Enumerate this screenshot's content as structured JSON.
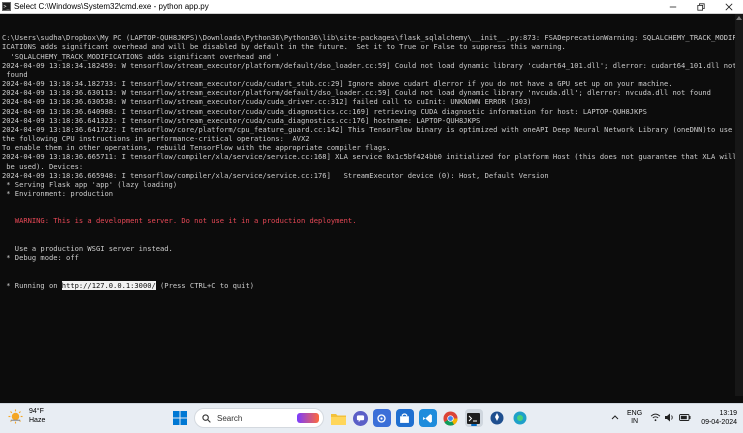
{
  "window": {
    "title": "Select C:\\Windows\\System32\\cmd.exe - python  app.py",
    "minimize": "–",
    "restore": "❐",
    "close": "✕"
  },
  "console": {
    "lines": [
      "C:\\Users\\sudha\\Dropbox\\My PC (LAPTOP-QUH8JKPS)\\Downloads\\Python36\\Python36\\lib\\site-packages\\flask_sqlalchemy\\__init__.py:873: FSADeprecationWarning: SQLALCHEMY_TRACK_MODIF",
      "ICATIONS adds significant overhead and will be disabled by default in the future.  Set it to True or False to suppress this warning.",
      "  'SQLALCHEMY_TRACK_MODIFICATIONS adds significant overhead and '",
      "2024-04-09 13:18:34.182459: W tensorflow/stream_executor/platform/default/dso_loader.cc:59] Could not load dynamic library 'cudart64_101.dll'; dlerror: cudart64_101.dll not",
      " found",
      "2024-04-09 13:18:34.182733: I tensorflow/stream_executor/cuda/cudart_stub.cc:29] Ignore above cudart dlerror if you do not have a GPU set up on your machine.",
      "2024-04-09 13:18:36.630113: W tensorflow/stream_executor/platform/default/dso_loader.cc:59] Could not load dynamic library 'nvcuda.dll'; dlerror: nvcuda.dll not found",
      "2024-04-09 13:18:36.630538: W tensorflow/stream_executor/cuda/cuda_driver.cc:312] failed call to cuInit: UNKNOWN ERROR (303)",
      "2024-04-09 13:18:36.640988: I tensorflow/stream_executor/cuda/cuda_diagnostics.cc:169] retrieving CUDA diagnostic information for host: LAPTOP-QUH8JKPS",
      "2024-04-09 13:18:36.641323: I tensorflow/stream_executor/cuda/cuda_diagnostics.cc:176] hostname: LAPTOP-QUH8JKPS",
      "2024-04-09 13:18:36.641722: I tensorflow/core/platform/cpu_feature_guard.cc:142] This TensorFlow binary is optimized with oneAPI Deep Neural Network Library (oneDNN)to use",
      "the following CPU instructions in performance-critical operations:  AVX2",
      "To enable them in other operations, rebuild TensorFlow with the appropriate compiler flags.",
      "2024-04-09 13:18:36.665711: I tensorflow/compiler/xla/service/service.cc:168] XLA service 0x1c5bf424bb0 initialized for platform Host (this does not guarantee that XLA will",
      " be used). Devices:",
      "2024-04-09 13:18:36.665948: I tensorflow/compiler/xla/service/service.cc:176]   StreamExecutor device (0): Host, Default Version",
      " * Serving Flask app 'app' (lazy loading)",
      " * Environment: production"
    ],
    "warning_line": "   WARNING: This is a development server. Do not use it in a production deployment.",
    "lines_after": [
      "   Use a production WSGI server instead.",
      " * Debug mode: off"
    ],
    "running_prefix": " * Running on ",
    "running_url": "http://127.0.0.1:3000/",
    "running_suffix": " (Press CTRL+C to quit)"
  },
  "taskbar": {
    "weather_temp": "94°F",
    "weather_desc": "Haze",
    "search_label": "Search",
    "lang_line1": "ENG",
    "lang_line2": "IN",
    "time": "13:19",
    "date": "09-04-2024"
  },
  "colors": {
    "console_bg": "#0c0c0c",
    "console_fg": "#cccccc",
    "warning": "#e74856",
    "taskbar_bg": "#e8edf3",
    "accent": "#0067c0"
  }
}
